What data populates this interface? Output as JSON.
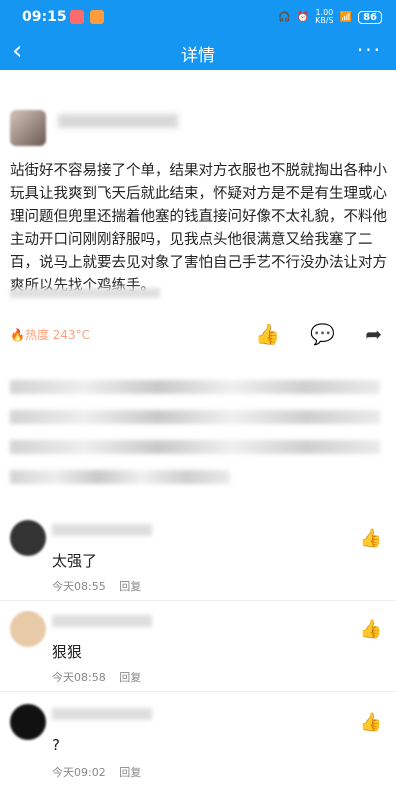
{
  "status": {
    "time": "09:15",
    "net": "1.00\nKB/S",
    "battery": "86"
  },
  "nav": {
    "back_icon": "‹",
    "title": "详情",
    "more_icon": "···"
  },
  "post": {
    "body": "站街好不容易接了个单，结果对方衣服也不脱就掏出各种小玩具让我爽到飞天后就此结束，怀疑对方是不是有生理或心理问题但兜里还揣着他塞的钱直接问好像不太礼貌，不料他主动开口问刚刚舒服吗，见我点头他很满意又给我塞了二百，说马上就要去见对象了害怕自己手艺不行没办法让对方爽所以先找个鸡练手。",
    "heat": "🔥热度 243°C",
    "like_icon": "👍",
    "comment_icon": "💬",
    "share_icon": "➦"
  },
  "comments": [
    {
      "text": "太强了",
      "time": "今天08:55",
      "reply": "回复",
      "like_icon": "👍"
    },
    {
      "text": "狠狠",
      "time": "今天08:58",
      "reply": "回复",
      "like_icon": "👍"
    },
    {
      "text": "?",
      "time": "今天09:02",
      "reply": "回复",
      "like_icon": "👍"
    }
  ]
}
